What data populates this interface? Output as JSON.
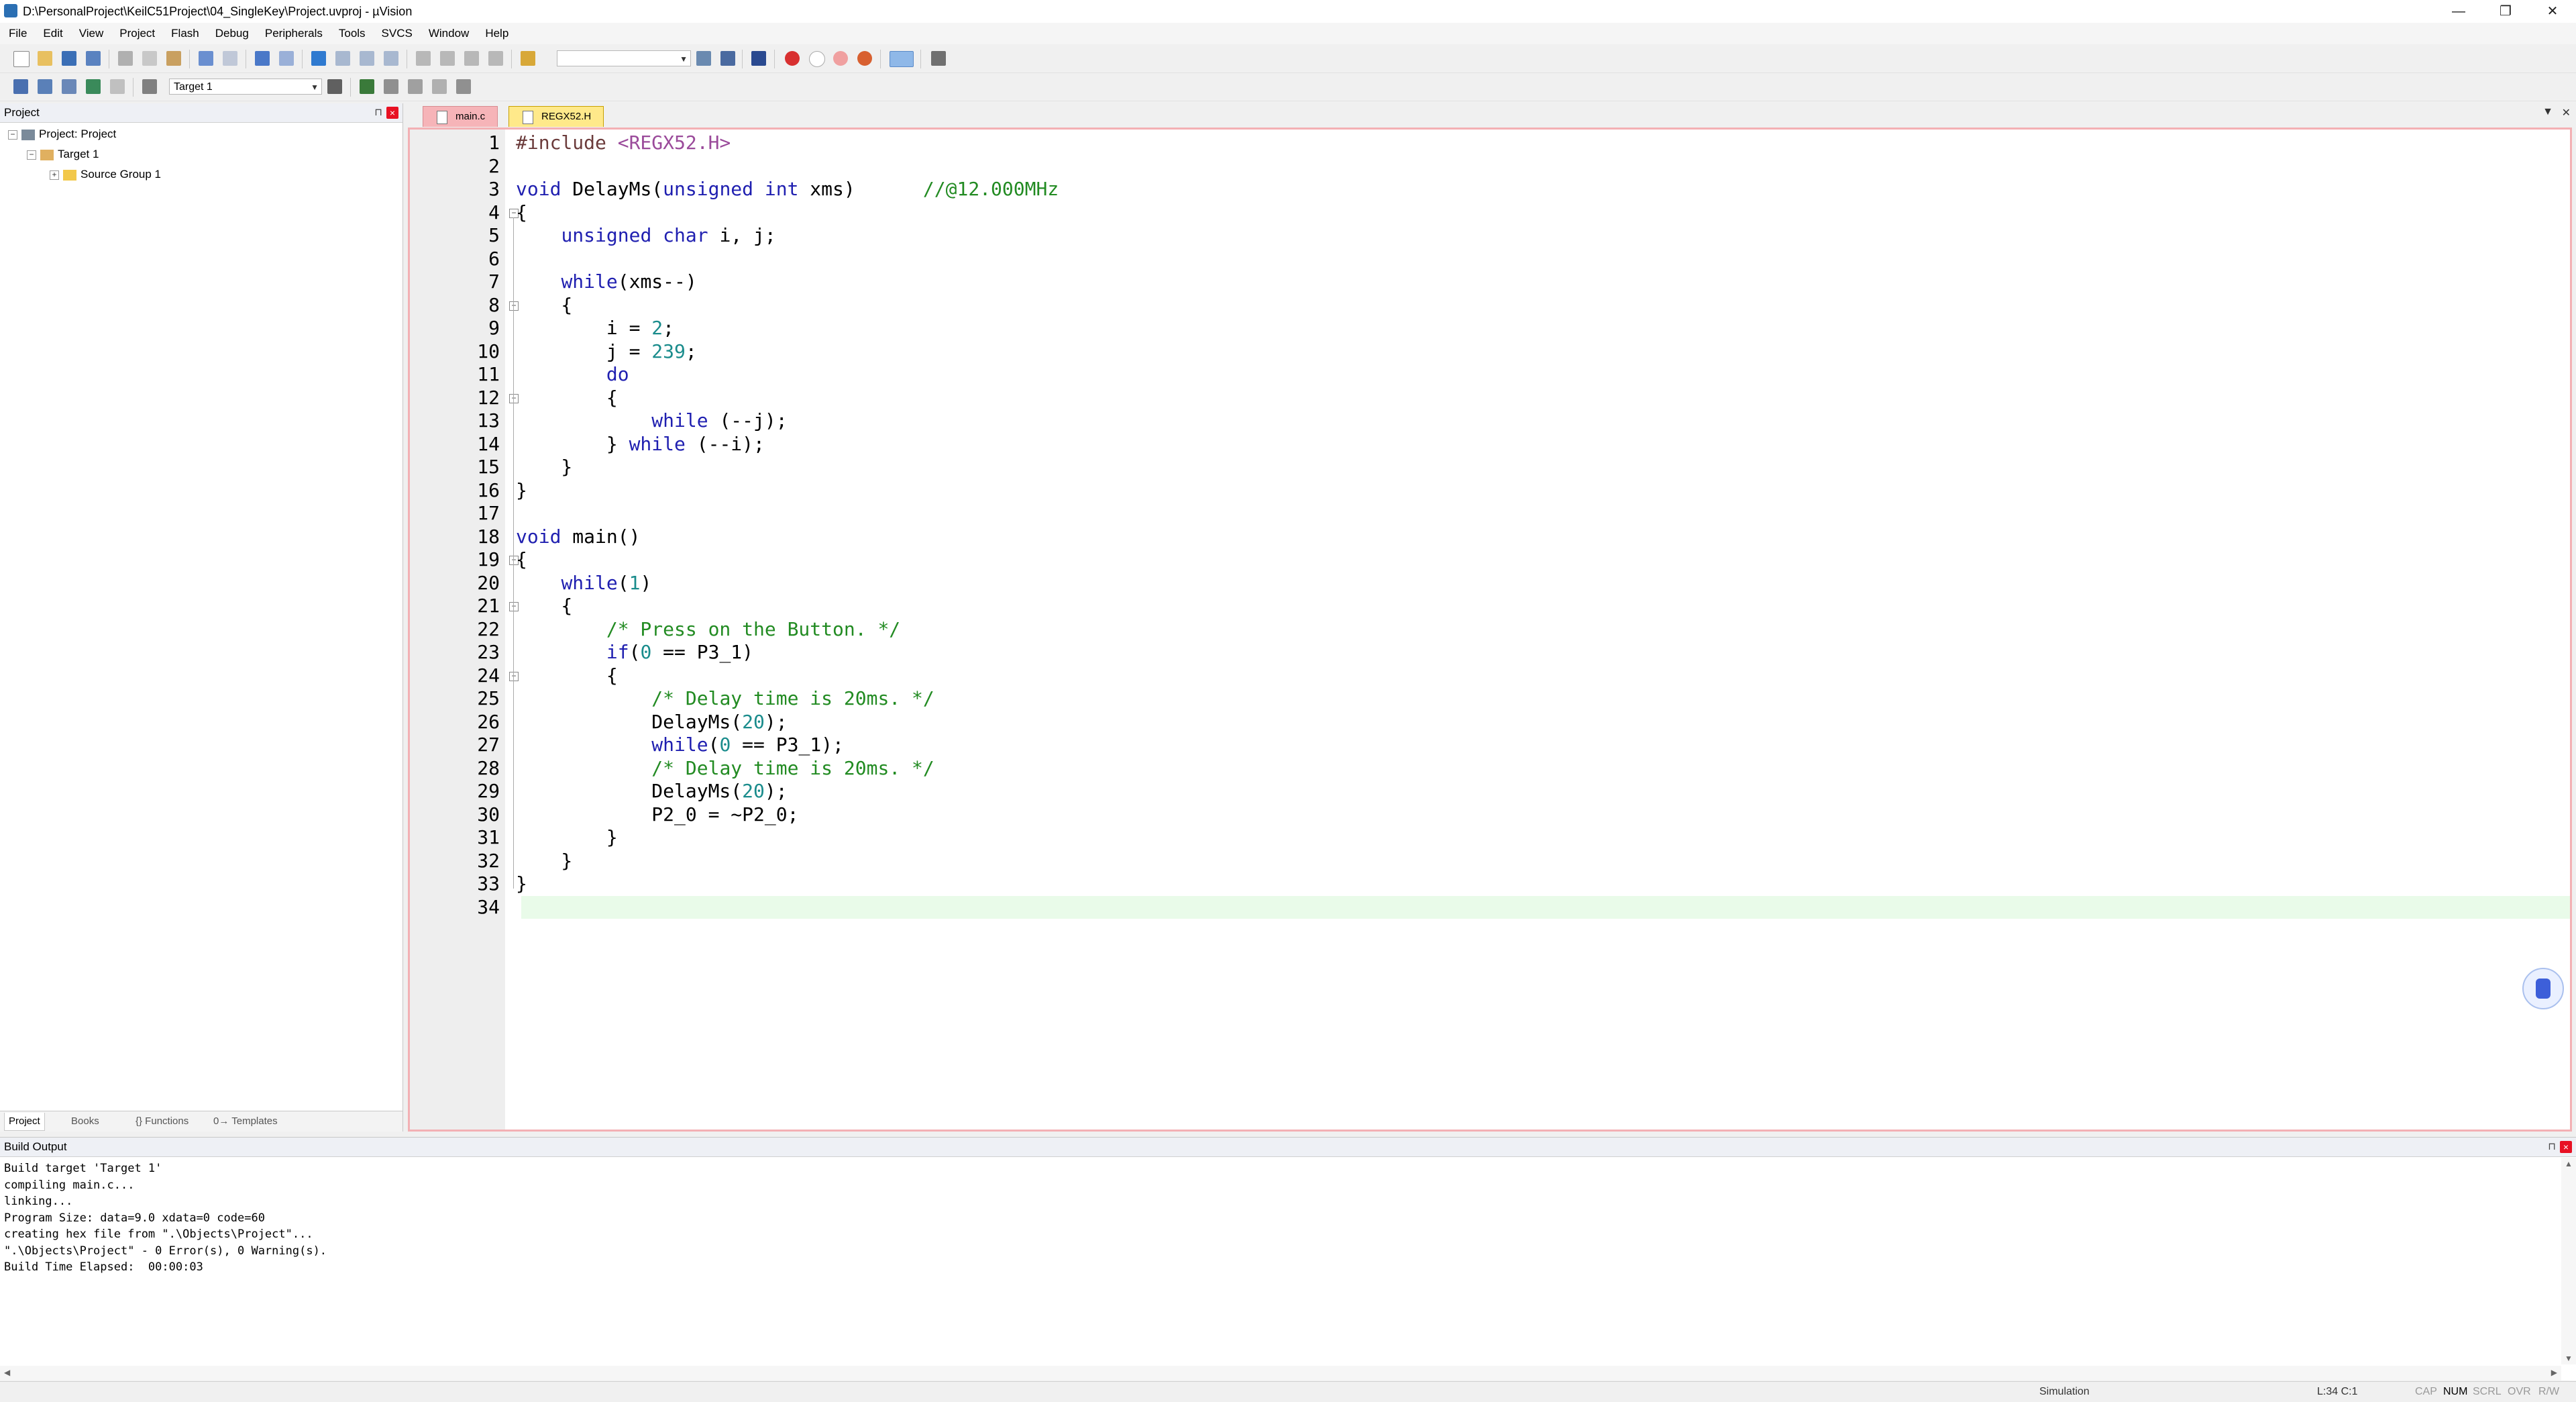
{
  "window": {
    "title": "D:\\PersonalProject\\KeilC51Project\\04_SingleKey\\Project.uvproj - µVision",
    "controls": [
      "—",
      "❐",
      "✕"
    ]
  },
  "menu": [
    "File",
    "Edit",
    "View",
    "Project",
    "Flash",
    "Debug",
    "Peripherals",
    "Tools",
    "SVCS",
    "Window",
    "Help"
  ],
  "toolbar2": {
    "target": "Target 1"
  },
  "project_panel": {
    "title": "Project",
    "tree": [
      {
        "label": "Project: Project",
        "level": 0,
        "expander": "⊟"
      },
      {
        "label": "Target 1",
        "level": 1,
        "expander": "⊟"
      },
      {
        "label": "Source Group 1",
        "level": 2,
        "expander": "⊞"
      }
    ],
    "tabs": [
      "Project",
      "Books",
      "{} Functions",
      "0→ Templates"
    ]
  },
  "editor": {
    "tabs": [
      {
        "label": "main.c",
        "active": true
      },
      {
        "label": "REGX52.H",
        "active": false
      }
    ],
    "cursor_line": 34,
    "line_numbers": [
      "1",
      "2",
      "3",
      "4",
      "5",
      "6",
      "7",
      "8",
      "9",
      "10",
      "11",
      "12",
      "13",
      "14",
      "15",
      "16",
      "17",
      "18",
      "19",
      "20",
      "21",
      "22",
      "23",
      "24",
      "25",
      "26",
      "27",
      "28",
      "29",
      "30",
      "31",
      "32",
      "33",
      "34"
    ],
    "fold_lines": [
      4,
      8,
      12,
      19,
      21,
      24
    ],
    "lines": [
      "#include <REGX52.H>",
      "",
      "void DelayMs(unsigned int xms)      //@12.000MHz",
      "{",
      "    unsigned char i, j;",
      "",
      "    while(xms--)",
      "    {",
      "        i = 2;",
      "        j = 239;",
      "        do",
      "        {",
      "            while (--j);",
      "        } while (--i);",
      "    }",
      "}",
      "",
      "void main()",
      "{",
      "    while(1)",
      "    {",
      "        /* Press on the Button. */",
      "        if(0 == P3_1)",
      "        {",
      "            /* Delay time is 20ms. */",
      "            DelayMs(20);",
      "            while(0 == P3_1);",
      "            /* Delay time is 20ms. */",
      "            DelayMs(20);",
      "            P2_0 = ~P2_0;",
      "        }",
      "    }",
      "}",
      ""
    ]
  },
  "build_output": {
    "title": "Build Output",
    "lines": [
      "Build target 'Target 1'",
      "compiling main.c...",
      "linking...",
      "Program Size: data=9.0 xdata=0 code=60",
      "creating hex file from \".\\Objects\\Project\"...",
      "\".\\Objects\\Project\" - 0 Error(s), 0 Warning(s).",
      "Build Time Elapsed:  00:00:03"
    ]
  },
  "status": {
    "mode": "Simulation",
    "position": "L:34 C:1",
    "caps": "CAP",
    "num": "NUM",
    "scrl": "SCRL",
    "ovr": "OVR",
    "rw": "R/W"
  }
}
